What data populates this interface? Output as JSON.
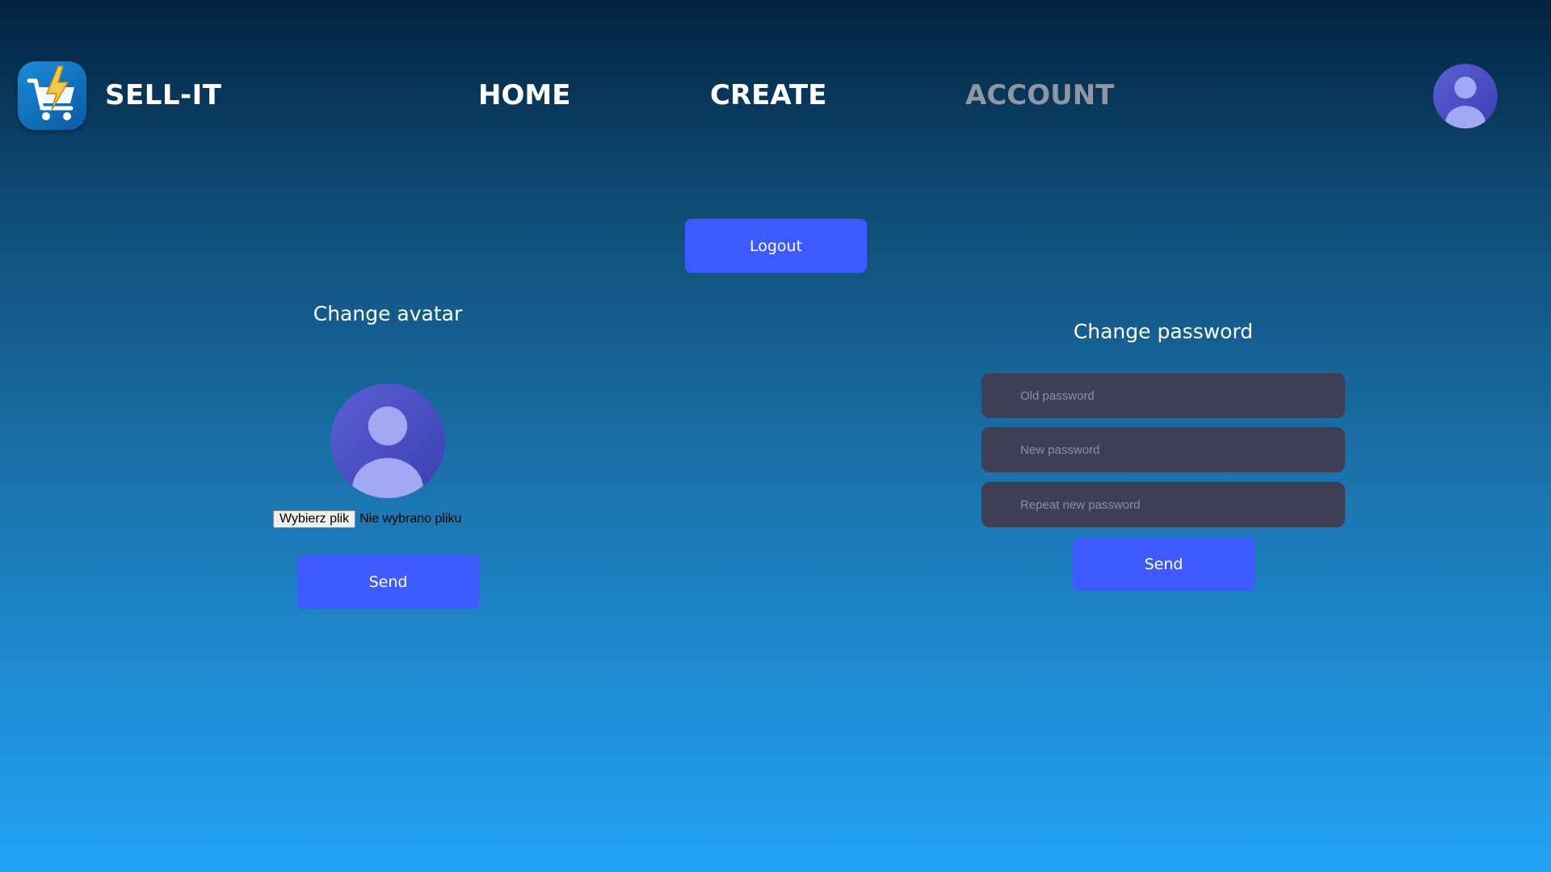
{
  "header": {
    "brand": "SELL-IT",
    "logo_icon": "shopping-cart-lightning-icon",
    "nav": {
      "home": "HOME",
      "create": "CREATE",
      "account": "ACCOUNT"
    },
    "active_nav": "account",
    "avatar_icon": "user-avatar-icon"
  },
  "logout": {
    "label": "Logout"
  },
  "avatar_section": {
    "title": "Change avatar",
    "avatar_icon": "user-avatar-icon",
    "file_button": "Wybierz plik",
    "file_status": "Nie wybrano pliku",
    "send_label": "Send"
  },
  "password_section": {
    "title": "Change password",
    "old_placeholder": "Old password",
    "new_placeholder": "New password",
    "repeat_placeholder": "Repeat new password",
    "old_value": "",
    "new_value": "",
    "repeat_value": "",
    "send_label": "Send"
  },
  "colors": {
    "accent": "#3d5afe",
    "input_bg": "#3e3e55",
    "nav_active": "#8f97a5",
    "avatar_bg": "#4a4fc4",
    "avatar_fg": "#a3a8f5"
  }
}
